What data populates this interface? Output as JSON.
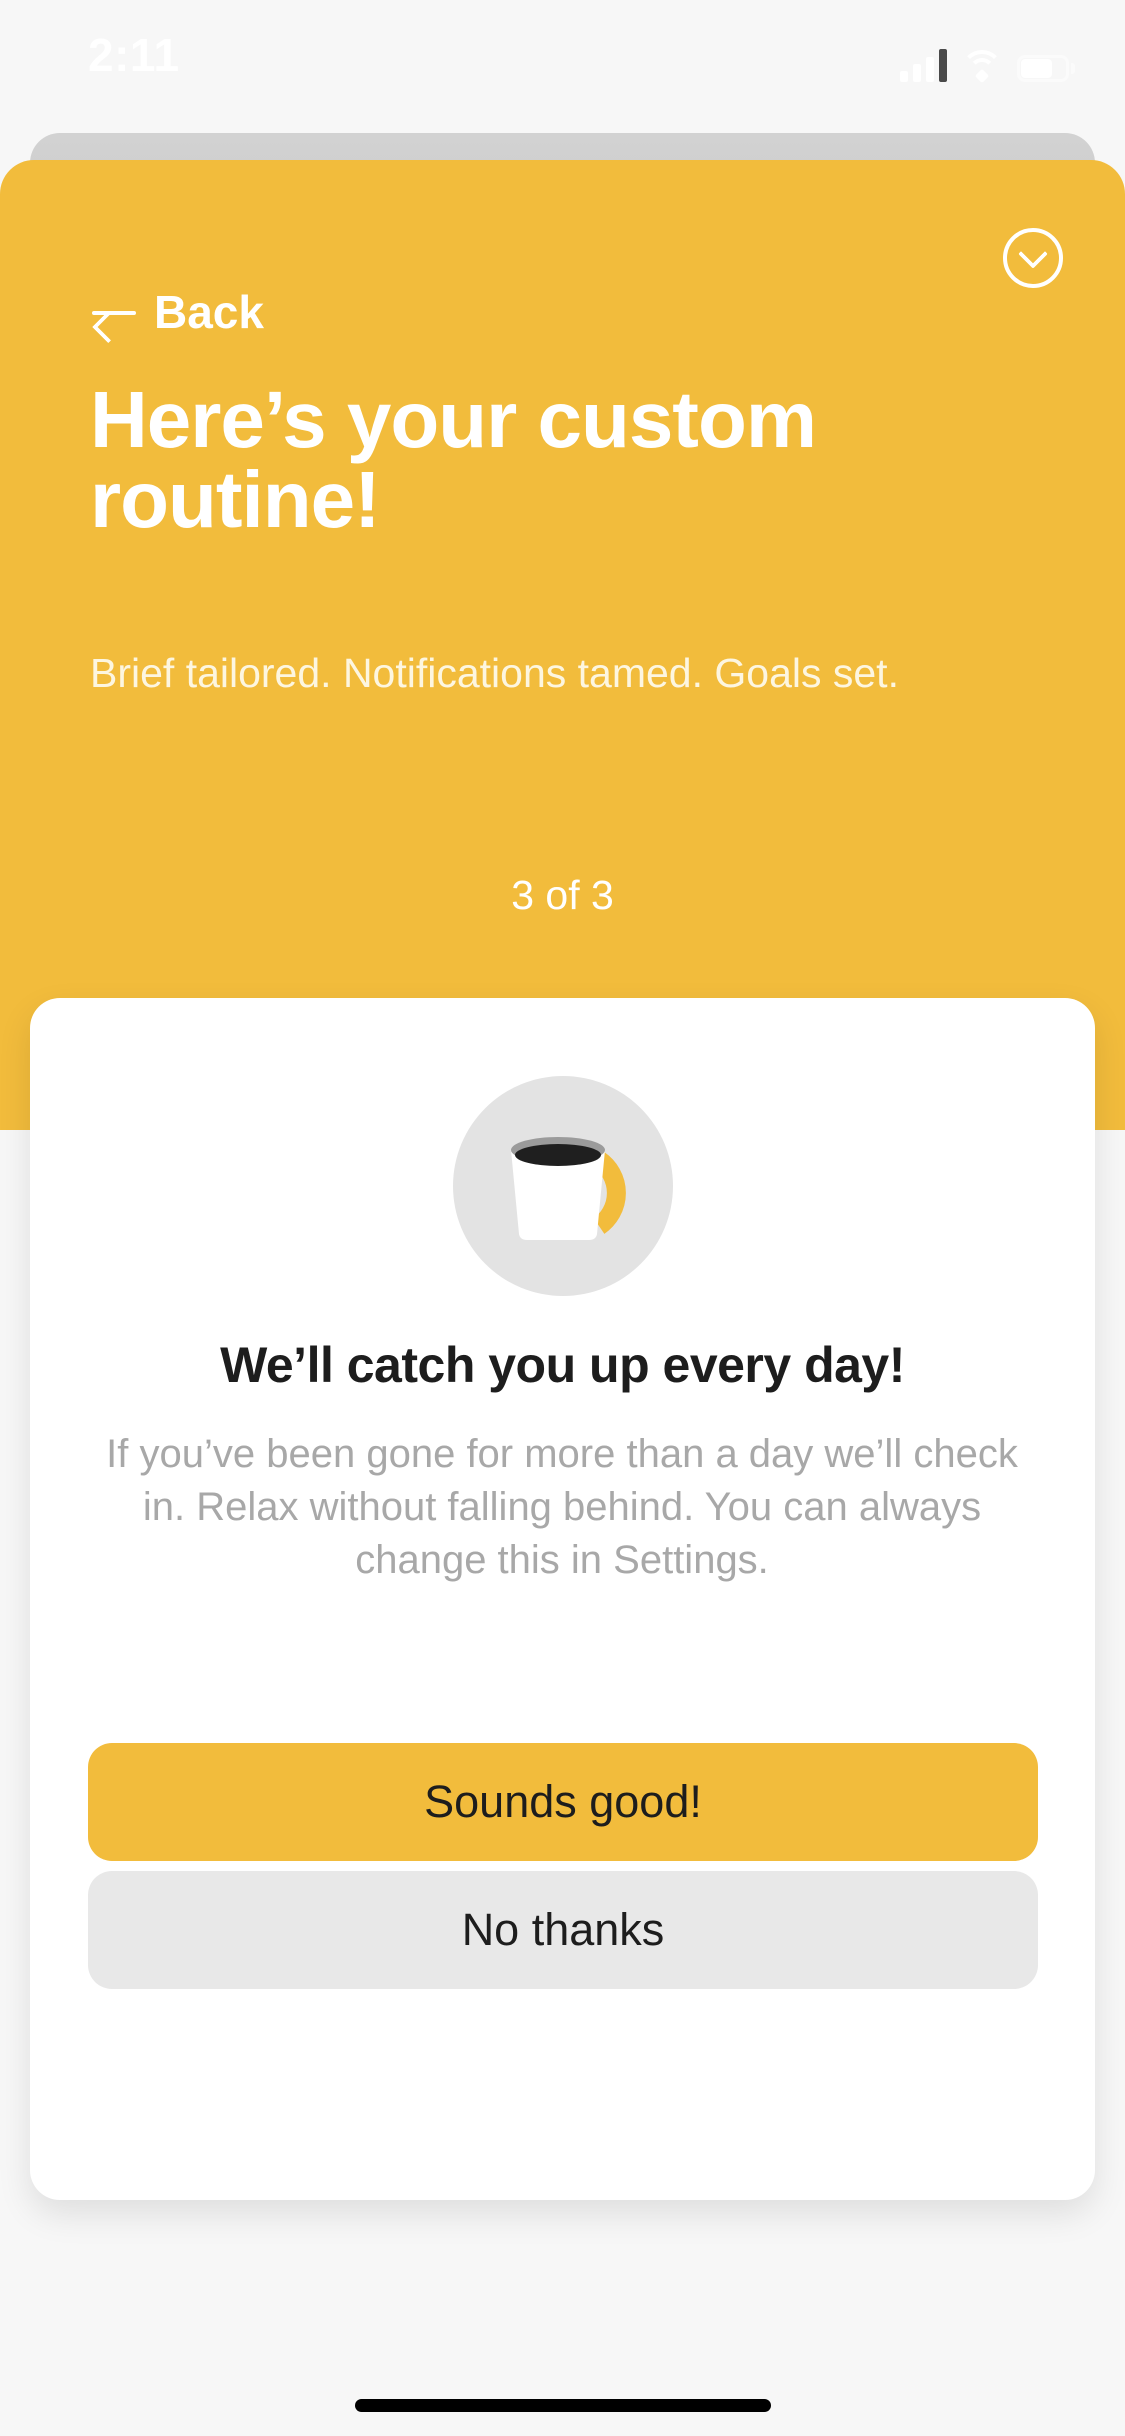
{
  "status_bar": {
    "time": "2:11",
    "signal_icon": "cellular-signal-icon",
    "wifi_icon": "wifi-icon",
    "battery_icon": "battery-icon",
    "signal_bars_active": 3,
    "signal_bars_total": 4,
    "battery_level_percent": 70
  },
  "header": {
    "close_icon": "chevron-down-circle-icon",
    "back_icon": "arrow-left-icon",
    "back_label": "Back",
    "title": "Here’s your custom routine!",
    "subtitle": "Brief tailored. Notifications tamed. Goals set.",
    "step_indicator": "3 of 3",
    "background_color": "#f2bc3c",
    "title_color": "#ffffff",
    "subtitle_color": "#fdf6e0"
  },
  "card": {
    "illustration_icon": "coffee-mug-icon",
    "illustration_circle_color": "#e3e3e3",
    "mug_body_color": "#ffffff",
    "mug_coffee_color": "#1f1f1f",
    "mug_rim_color": "#9b9b9b",
    "mug_handle_color": "#f2bc3c",
    "title": "We’ll catch you up every day!",
    "body": "If you’ve been gone for more than a day we’ll check in. Relax without falling behind. You can always change this in Settings.",
    "title_color": "#1d1d1d",
    "body_color": "#a8a8a8",
    "primary_button_label": "Sounds good!",
    "primary_button_color": "#f2bc3c",
    "secondary_button_label": "No thanks",
    "secondary_button_color": "#e8e8e8"
  },
  "page": {
    "background_color": "#f7f7f7",
    "home_indicator_color": "#000000"
  }
}
